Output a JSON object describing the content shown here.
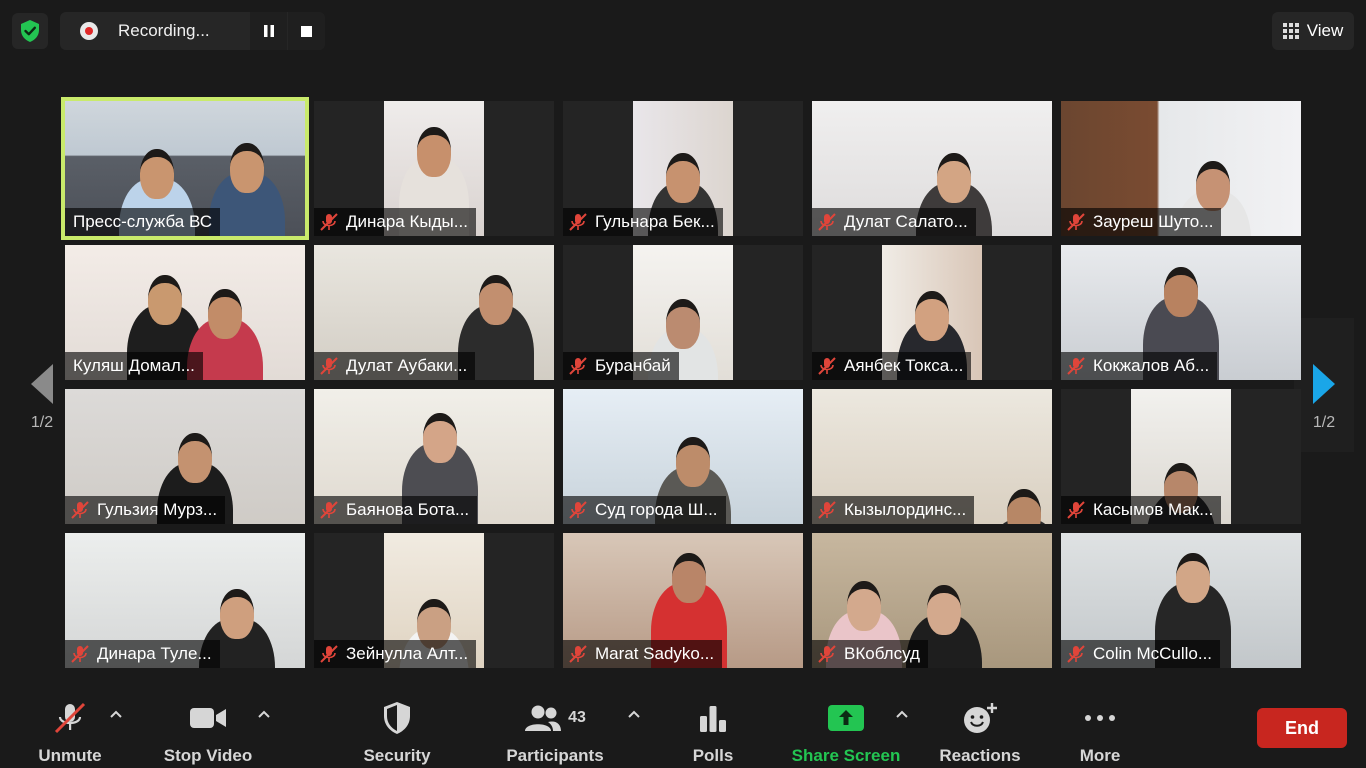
{
  "topbar": {
    "recording_label": "Recording...",
    "view_label": "View"
  },
  "pagination": {
    "left_page": "1/2",
    "right_page": "1/2"
  },
  "participants": [
    {
      "name": "Пресс-служба ВС",
      "muted": false,
      "active": true
    },
    {
      "name": "Динара Кыды...",
      "muted": true
    },
    {
      "name": "Гульнара Бек...",
      "muted": true
    },
    {
      "name": "Дулат Салато...",
      "muted": true
    },
    {
      "name": "Зауреш Шуто...",
      "muted": true
    },
    {
      "name": "Куляш Домал...",
      "muted": false
    },
    {
      "name": "Дулат Аубаки...",
      "muted": true
    },
    {
      "name": "Буранбай",
      "muted": true
    },
    {
      "name": "Аянбек Токса...",
      "muted": true
    },
    {
      "name": "Кокжалов Аб...",
      "muted": true
    },
    {
      "name": "Гульзия Мурз...",
      "muted": true
    },
    {
      "name": "Баянова Бота...",
      "muted": true
    },
    {
      "name": "Суд города Ш...",
      "muted": true
    },
    {
      "name": "Кызылординс...",
      "muted": true
    },
    {
      "name": "Касымов Мак...",
      "muted": true
    },
    {
      "name": "Динара Туле...",
      "muted": true
    },
    {
      "name": "Зейнулла Алт...",
      "muted": true
    },
    {
      "name": "Marat Sadyko...",
      "muted": true
    },
    {
      "name": "ВКоблсуд",
      "muted": true
    },
    {
      "name": "Colin McCullo...",
      "muted": true
    }
  ],
  "controls": {
    "unmute": "Unmute",
    "stop_video": "Stop Video",
    "security": "Security",
    "participants": "Participants",
    "participants_count": "43",
    "polls": "Polls",
    "share_screen": "Share Screen",
    "reactions": "Reactions",
    "more": "More",
    "end": "End"
  },
  "colors": {
    "active_speaker_outline": "#c9ea6b",
    "share_green": "#23c552",
    "end_red": "#c8261f",
    "muted_red": "#e0453a",
    "nav_arrow_blue": "#1aa6e8"
  }
}
